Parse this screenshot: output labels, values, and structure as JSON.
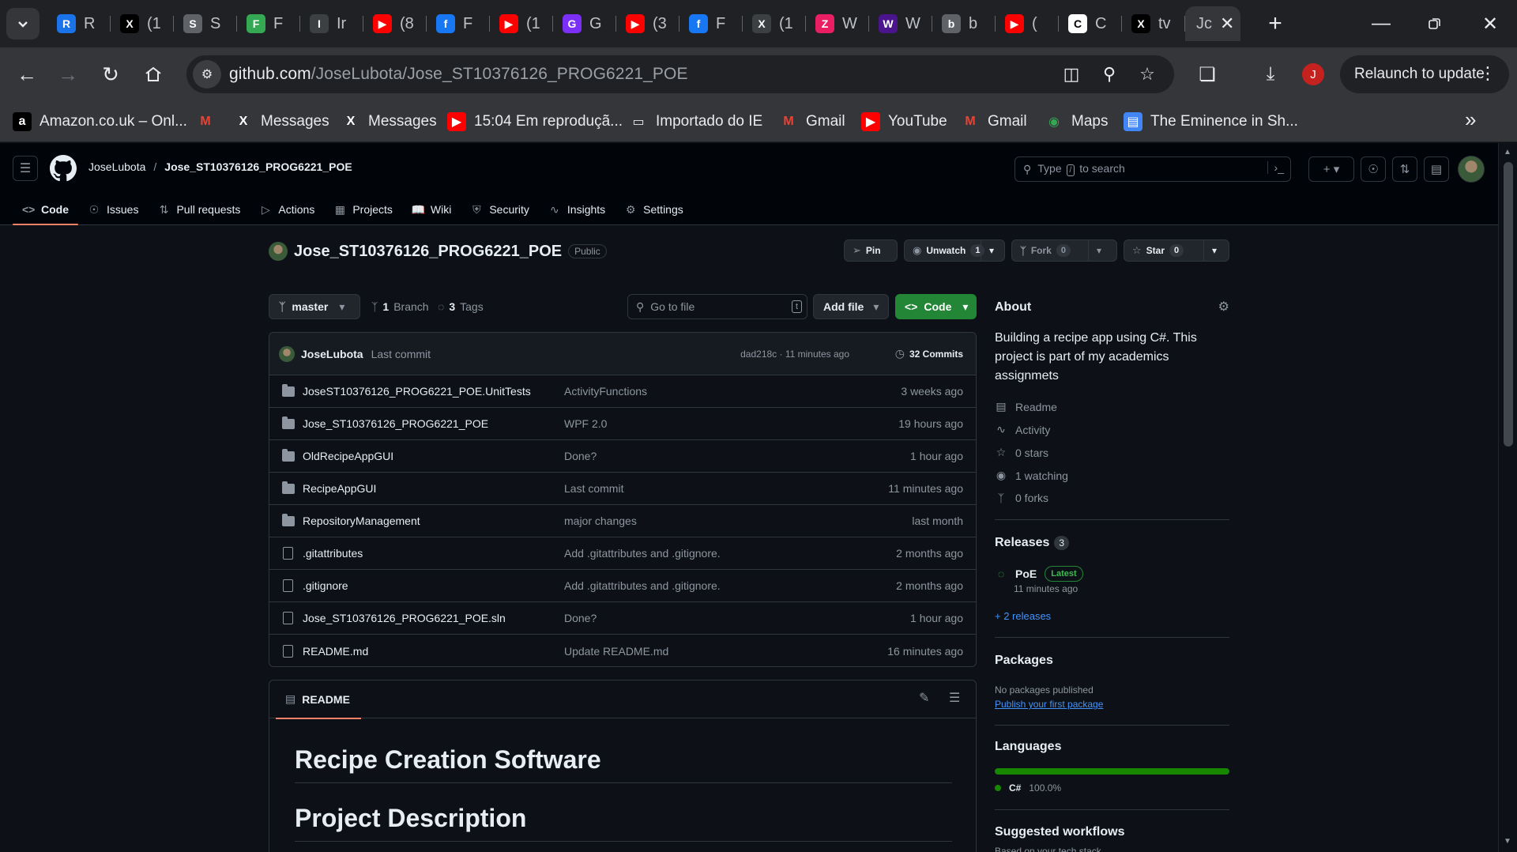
{
  "browser": {
    "tabs": [
      {
        "letter": "R",
        "bg": "#1a73e8",
        "title": "R"
      },
      {
        "letter": "X",
        "bg": "#000000",
        "title": "(1"
      },
      {
        "letter": "S",
        "bg": "#5f6368",
        "title": "S"
      },
      {
        "letter": "F",
        "bg": "#34a853",
        "title": "F"
      },
      {
        "letter": "I",
        "bg": "#3c4043",
        "title": "Ir"
      },
      {
        "letter": "▶",
        "bg": "#ff0000",
        "title": "(8"
      },
      {
        "letter": "f",
        "bg": "#1877f2",
        "title": "F"
      },
      {
        "letter": "▶",
        "bg": "#ff0000",
        "title": "(1"
      },
      {
        "letter": "G",
        "bg": "#7b2ff7",
        "title": "G"
      },
      {
        "letter": "▶",
        "bg": "#ff0000",
        "title": "(3"
      },
      {
        "letter": "f",
        "bg": "#1877f2",
        "title": "F"
      },
      {
        "letter": "X",
        "bg": "#3c4043",
        "title": "(1"
      },
      {
        "letter": "Z",
        "bg": "#e91e63",
        "title": "W"
      },
      {
        "letter": "W",
        "bg": "#4a148c",
        "title": "W"
      },
      {
        "letter": "b",
        "bg": "#5f6368",
        "title": "b"
      },
      {
        "letter": "▶",
        "bg": "#ff0000",
        "title": "("
      },
      {
        "letter": "C",
        "bg": "#ffffff",
        "title": "C"
      },
      {
        "letter": "X",
        "bg": "#000000",
        "title": "tv"
      }
    ],
    "active_tab_title": "Jc",
    "url_host": "github.com",
    "url_path": "/JoseLubota/Jose_ST10376126_PROG6221_POE",
    "profile_initial": "J",
    "relaunch_label": "Relaunch to update",
    "bookmarks": [
      {
        "icon": "a",
        "color": "#ffffff",
        "bg": "#000000",
        "label": "Amazon.co.uk – Onl..."
      },
      {
        "icon": "M",
        "color": "#ea4335",
        "bg": "transparent",
        "label": ""
      },
      {
        "icon": "X",
        "color": "#ffffff",
        "bg": "transparent",
        "label": "Messages"
      },
      {
        "icon": "X",
        "color": "#ffffff",
        "bg": "transparent",
        "label": "Messages"
      },
      {
        "icon": "▶",
        "color": "#ffffff",
        "bg": "#ff0000",
        "label": "15:04 Em reproduçã..."
      },
      {
        "icon": "▭",
        "color": "#e8eaed",
        "bg": "transparent",
        "label": "Importado do IE"
      },
      {
        "icon": "M",
        "color": "#ea4335",
        "bg": "transparent",
        "label": "Gmail"
      },
      {
        "icon": "▶",
        "color": "#ffffff",
        "bg": "#ff0000",
        "label": "YouTube"
      },
      {
        "icon": "M",
        "color": "#ea4335",
        "bg": "transparent",
        "label": "Gmail"
      },
      {
        "icon": "◉",
        "color": "#34a853",
        "bg": "transparent",
        "label": "Maps"
      },
      {
        "icon": "▤",
        "color": "#ffffff",
        "bg": "#4285f4",
        "label": "The Eminence in Sh..."
      }
    ]
  },
  "github": {
    "owner": "JoseLubota",
    "repo": "Jose_ST10376126_PROG6221_POE",
    "search_placeholder_pre": "Type",
    "search_key": "/",
    "search_placeholder_post": "to search",
    "nav": [
      "Code",
      "Issues",
      "Pull requests",
      "Actions",
      "Projects",
      "Wiki",
      "Security",
      "Insights",
      "Settings"
    ],
    "visibility": "Public",
    "pin_label": "Pin",
    "unwatch_label": "Unwatch",
    "watch_count": "1",
    "fork_label": "Fork",
    "fork_count": "0",
    "star_label": "Star",
    "star_count": "0",
    "branch": "master",
    "branch_count": "1",
    "branch_label": "Branch",
    "tag_count": "3",
    "tag_label": "Tags",
    "goto_placeholder": "Go to file",
    "goto_key": "t",
    "add_file_label": "Add file",
    "code_label": "Code",
    "last_commit": {
      "user": "JoseLubota",
      "message": "Last commit",
      "meta": "dad218c · 11 minutes ago",
      "commits": "32 Commits"
    },
    "files": [
      {
        "type": "folder",
        "name": "JoseST10376126_PROG6221_POE.UnitTests",
        "message": "ActivityFunctions",
        "date": "3 weeks ago"
      },
      {
        "type": "folder",
        "name": "Jose_ST10376126_PROG6221_POE",
        "message": "WPF 2.0",
        "date": "19 hours ago"
      },
      {
        "type": "folder",
        "name": "OldRecipeAppGUI",
        "message": "Done?",
        "date": "1 hour ago"
      },
      {
        "type": "folder",
        "name": "RecipeAppGUI",
        "message": "Last commit",
        "date": "11 minutes ago"
      },
      {
        "type": "folder",
        "name": "RepositoryManagement",
        "message": "major changes",
        "date": "last month"
      },
      {
        "type": "file",
        "name": ".gitattributes",
        "message": "Add .gitattributes and .gitignore.",
        "date": "2 months ago"
      },
      {
        "type": "file",
        "name": ".gitignore",
        "message": "Add .gitattributes and .gitignore.",
        "date": "2 months ago"
      },
      {
        "type": "file",
        "name": "Jose_ST10376126_PROG6221_POE.sln",
        "message": "Done?",
        "date": "1 hour ago"
      },
      {
        "type": "file",
        "name": "README.md",
        "message": "Update README.md",
        "date": "16 minutes ago"
      }
    ],
    "readme": {
      "tab": "README",
      "h1": "Recipe Creation Software",
      "h2": "Project Description"
    },
    "about": {
      "title": "About",
      "description": "Building a recipe app using C#. This project is part of my academics assignmets",
      "items": [
        "Readme",
        "Activity",
        "0 stars",
        "1 watching",
        "0 forks"
      ]
    },
    "releases": {
      "title": "Releases",
      "count": "3",
      "name": "PoE",
      "badge": "Latest",
      "time": "11 minutes ago",
      "more": "+ 2 releases"
    },
    "packages": {
      "title": "Packages",
      "none": "No packages published",
      "link": "Publish your first package"
    },
    "languages": {
      "title": "Languages",
      "name": "C#",
      "percent": "100.0%",
      "share": 1.0,
      "color": "#178600"
    },
    "workflows": {
      "title": "Suggested workflows",
      "subtitle": "Based on your tech stack"
    }
  }
}
